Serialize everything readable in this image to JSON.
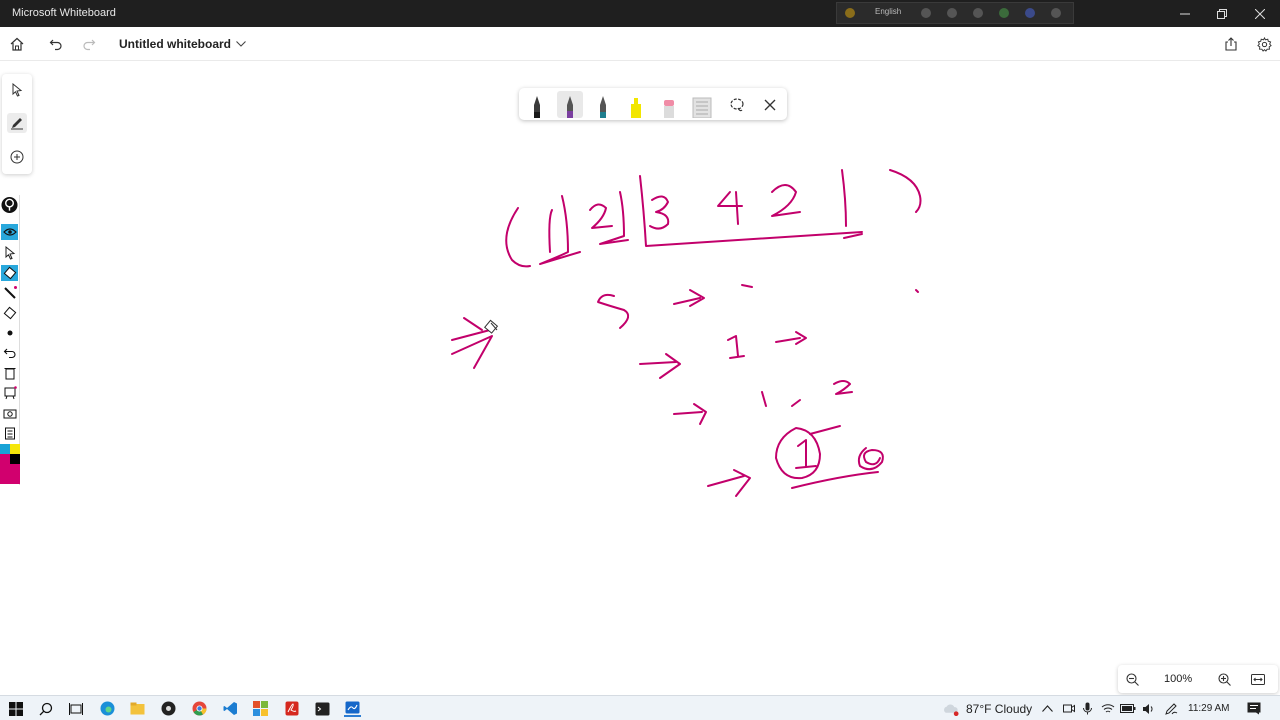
{
  "window": {
    "title": "Microsoft Whiteboard",
    "overlay_language": "English",
    "controls": [
      "minimize-icon",
      "restore-icon",
      "close-icon"
    ]
  },
  "appbar": {
    "home_icon": "home-icon",
    "undo_icon": "undo-icon",
    "redo_icon": "redo-icon",
    "doc_title": "Untitled whiteboard",
    "share_icon": "share-icon",
    "settings_icon": "gear-icon"
  },
  "left_toolbar": {
    "items": [
      "select-arrow-icon",
      "pen-icon",
      "add-icon"
    ],
    "selected": "pen-icon"
  },
  "pen_toolbar": {
    "tools": [
      {
        "name": "black-pen",
        "color": "#1a1a1a"
      },
      {
        "name": "purple-pen",
        "color": "#7b3fa0"
      },
      {
        "name": "teal-pen",
        "color": "#1f7f8f"
      },
      {
        "name": "yellow-highlighter",
        "color": "#f2e600"
      },
      {
        "name": "eraser",
        "color": "#f08ca6"
      },
      {
        "name": "ruler",
        "color": "#c8c8c8"
      },
      {
        "name": "lasso",
        "color": "#333333"
      },
      {
        "name": "close",
        "color": "#333333"
      }
    ],
    "selected": "purple-pen"
  },
  "annotation_toolbar": {
    "colors": [
      "#19a3d6",
      "#f5e60a",
      "#000000",
      "#d1006e"
    ]
  },
  "ink": {
    "color": "#c2006b"
  },
  "zoom": {
    "value": "100%"
  },
  "taskbar": {
    "apps": [
      "windows-start-icon",
      "search-icon",
      "task-view-icon",
      "edge-icon",
      "file-explorer-icon",
      "obs-icon",
      "chrome-icon",
      "vscode-icon",
      "office-icon",
      "acrobat-icon",
      "terminal-icon",
      "whiteboard-icon"
    ],
    "weather": "87°F  Cloudy",
    "time": "11:29 AM"
  }
}
